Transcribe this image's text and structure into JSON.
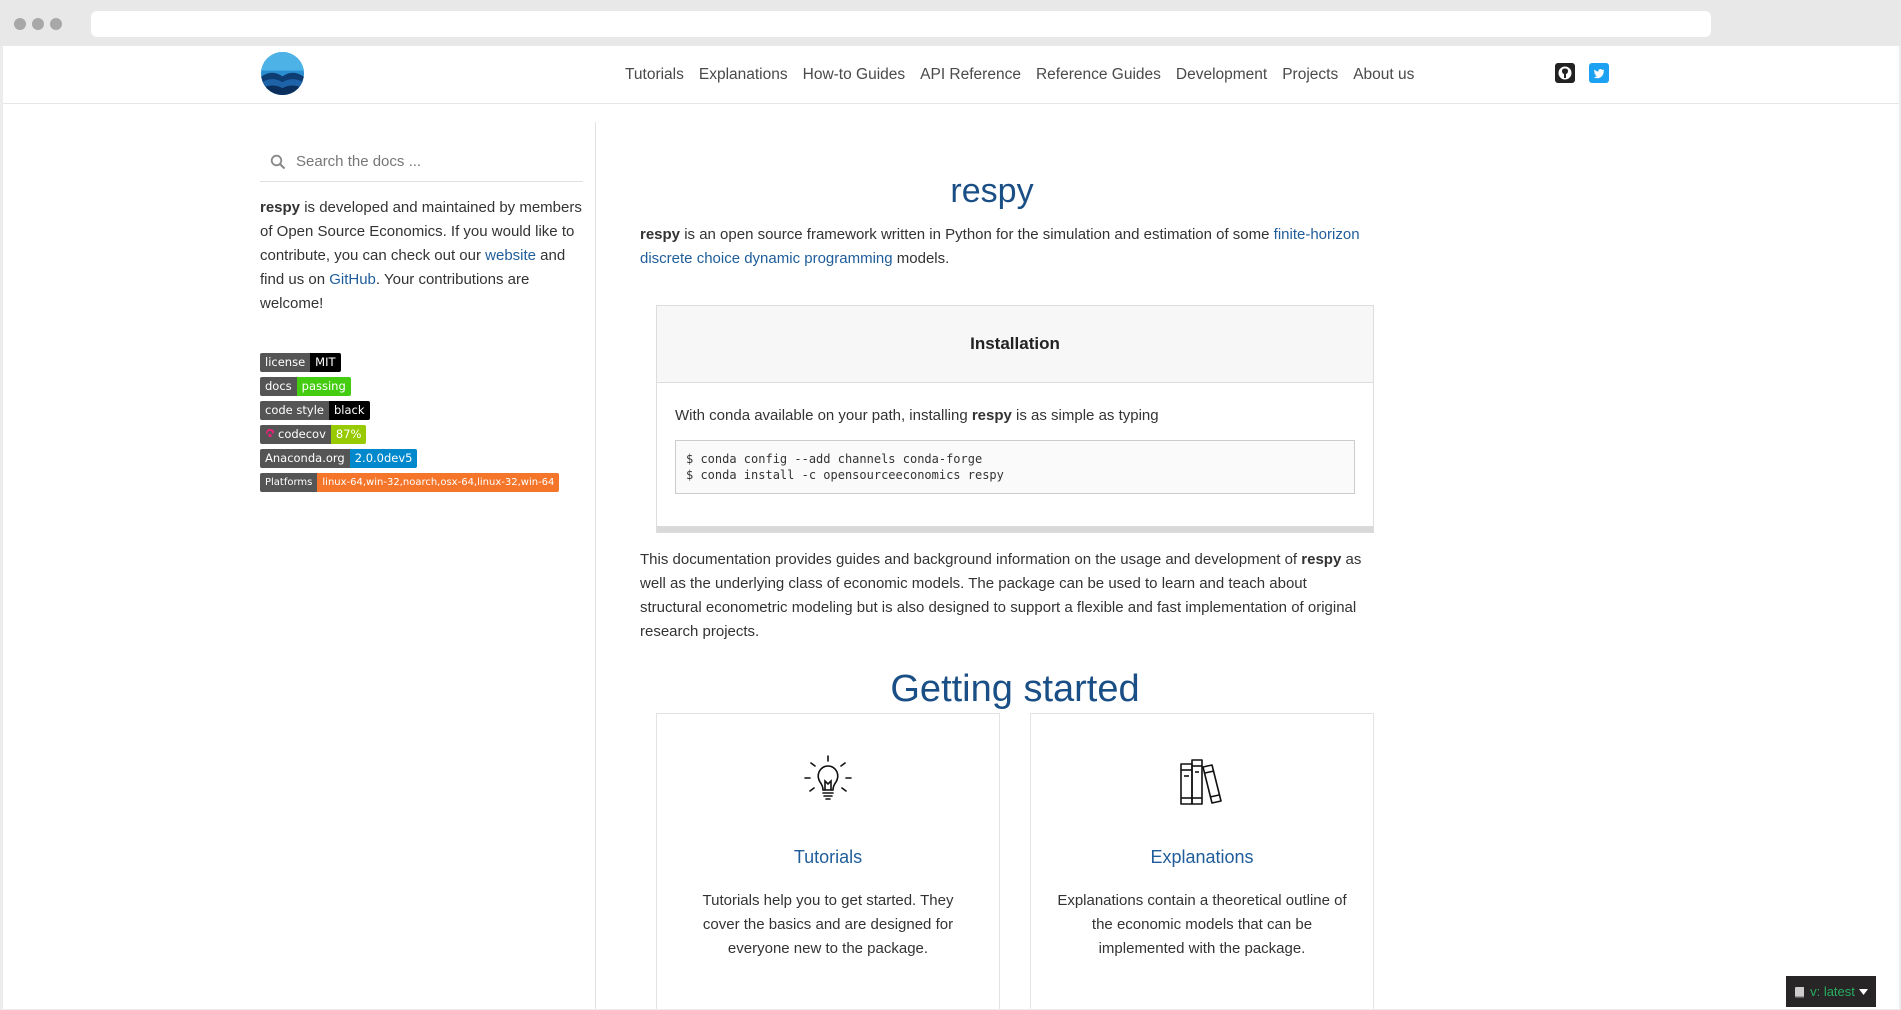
{
  "nav": {
    "links": [
      "Tutorials",
      "Explanations",
      "How-to Guides",
      "API Reference",
      "Reference Guides",
      "Development",
      "Projects",
      "About us"
    ]
  },
  "icons": {
    "logo": "respy-logo",
    "github": "github-icon",
    "twitter": "twitter-icon",
    "search": "search-icon",
    "tutorials": "lightbulb-icon",
    "explanations": "books-icon",
    "version": "book-icon"
  },
  "sidebar": {
    "search_placeholder": "Search the docs ...",
    "about": {
      "brand": "respy",
      "text1": " is developed and maintained by members of Open Source Economics. If you would like to contribute, you can check out our ",
      "link1": "website",
      "text2": " and find us on ",
      "link2": "GitHub",
      "text3": ". Your contributions are welcome!"
    },
    "badges": [
      {
        "label": "license",
        "value": "MIT",
        "color": "#000000"
      },
      {
        "label": "docs",
        "value": "passing",
        "color": "#4c1"
      },
      {
        "label": "code style",
        "value": "black",
        "color": "#000000"
      },
      {
        "label": "codecov",
        "value": "87%",
        "color": "#97ca00"
      },
      {
        "label": "Anaconda.org",
        "value": "2.0.0dev5",
        "color": "#0088cc"
      },
      {
        "label": "Platforms",
        "value": "linux-64,win-32,noarch,osx-64,linux-32,win-64",
        "color": "#f5762a"
      }
    ]
  },
  "main": {
    "title": "respy",
    "intro": {
      "brand": "respy",
      "text1": " is an open source framework written in Python for the simulation and estimation of some ",
      "link": "finite-horizon discrete choice dynamic programming",
      "text2": " models."
    },
    "installation": {
      "heading": "Installation",
      "text1": "With conda available on your path, installing ",
      "brand": "respy",
      "text2": " is as simple as typing",
      "code": "$ conda config --add channels conda-forge\n$ conda install -c opensourceeconomics respy"
    },
    "description": {
      "text1": "This documentation provides guides and background information on the usage and development of ",
      "brand": "respy",
      "text2": " as well as the underlying class of economic models. The package can be used to learn and teach about structural econometric modeling but is also designed to support a flexible and fast implementation of original research projects."
    },
    "getting_started": "Getting started",
    "cards": [
      {
        "title": "Tutorials",
        "text": "Tutorials help you to get started. They cover the basics and are designed for everyone new to the package."
      },
      {
        "title": "Explanations",
        "text": "Explanations contain a theoretical outline of the economic models that can be implemented with the package."
      }
    ]
  },
  "version_badge": "v: latest",
  "colors": {
    "link": "#1f5d9a",
    "heading": "#1a4f86",
    "twitter": "#1da1f2"
  }
}
